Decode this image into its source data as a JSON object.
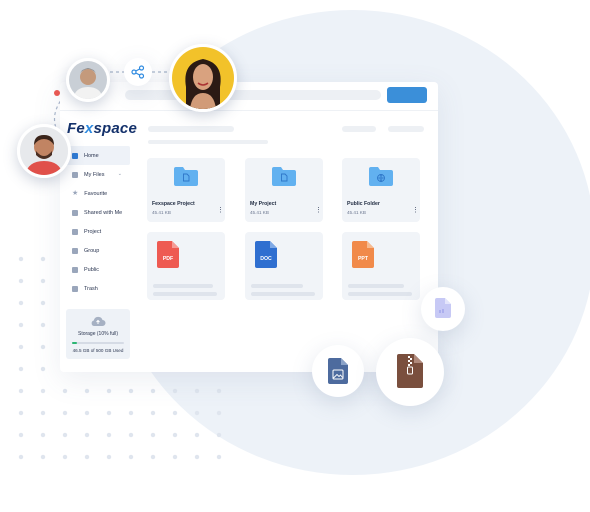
{
  "brand": {
    "logo_pre": "Fe",
    "logo_x": "x",
    "logo_post": "space",
    "accent": "#3b8fd9"
  },
  "sidebar": {
    "items": [
      {
        "label": "Home",
        "icon": "home-icon",
        "active": true
      },
      {
        "label": "My Files",
        "icon": "file-icon",
        "expandable": true
      },
      {
        "label": "Favourite",
        "icon": "star-icon"
      },
      {
        "label": "Shared with Me",
        "icon": "shared-icon"
      },
      {
        "label": "Project",
        "icon": "folder-icon"
      },
      {
        "label": "Group",
        "icon": "group-icon"
      },
      {
        "label": "Public",
        "icon": "public-icon"
      },
      {
        "label": "Trash",
        "icon": "trash-icon"
      }
    ]
  },
  "storage": {
    "label": "Storage (10% full)",
    "used_fraction": 0.1,
    "capacity": "46.5 GB of 500 GB Used"
  },
  "folders": [
    {
      "name": "Fexspace Project",
      "size": "45.41 KB",
      "icon": "file-icon"
    },
    {
      "name": "My Project",
      "size": "45.41 KB",
      "icon": "file-icon"
    },
    {
      "name": "Public Folder",
      "size": "45.41 KB",
      "icon": "globe-icon"
    }
  ],
  "documents": [
    {
      "label": "PDF",
      "color": "#ee5a52"
    },
    {
      "label": "DOC",
      "color": "#2f6fd0"
    },
    {
      "label": "PPT",
      "color": "#f18a4a"
    }
  ],
  "floating_icons": [
    "share-icon",
    "document-icon",
    "image-file-icon",
    "zip-file-icon"
  ]
}
